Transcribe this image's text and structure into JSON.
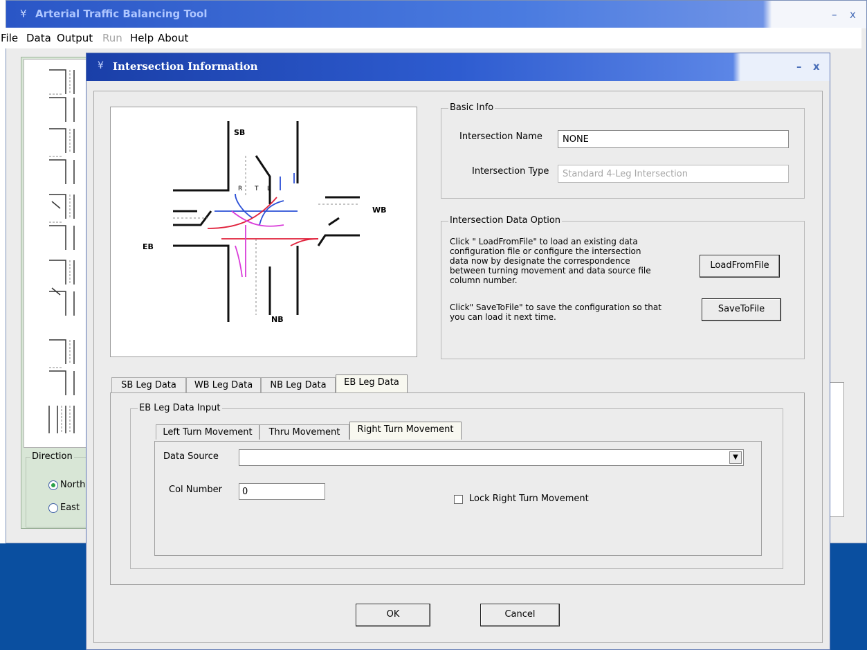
{
  "main_window": {
    "title": "Arterial Traffic Balancing Tool",
    "controls": {
      "minimize": "–",
      "close": "x"
    },
    "menu": [
      {
        "label": "File",
        "enabled": true
      },
      {
        "label": "Data",
        "enabled": true
      },
      {
        "label": "Output",
        "enabled": true
      },
      {
        "label": "Run",
        "enabled": false
      },
      {
        "label": "Help",
        "enabled": true
      },
      {
        "label": "About",
        "enabled": true
      }
    ],
    "direction_group": {
      "legend": "Direction",
      "options": [
        {
          "label": "North",
          "selected": true
        },
        {
          "label": "East",
          "selected": false
        }
      ]
    }
  },
  "dialog": {
    "title": "Intersection Information",
    "controls": {
      "minimize": "–",
      "close": "x"
    },
    "diagram_labels": {
      "sb": "SB",
      "wb": "WB",
      "eb": "EB",
      "nb": "NB",
      "r": "R",
      "t": "T",
      "l": "L"
    },
    "basic_info": {
      "legend": "Basic Info",
      "name_label": "Intersection Name",
      "name_value": "NONE",
      "type_label": "Intersection Type",
      "type_value": "Standard 4-Leg Intersection"
    },
    "data_option": {
      "legend": "Intersection Data Option",
      "load_desc": "Click \" LoadFromFile\" to load an existing data configuration file or configure the intersection data now by designate the correspondence between turning movement and data source file column number.",
      "save_desc": "Click\" SaveToFile\" to save the configuration so that you can load it next time.",
      "load_button": "LoadFromFile",
      "save_button": "SaveToFile"
    },
    "leg_tabs": [
      "SB Leg Data",
      "WB Leg Data",
      "NB Leg Data",
      "EB Leg Data"
    ],
    "active_leg_tab": "EB Leg Data",
    "leg_input": {
      "legend": "EB Leg  Data Input",
      "movement_tabs": [
        "Left Turn Movement",
        "Thru Movement",
        "Right Turn Movement"
      ],
      "active_movement_tab": "Right Turn Movement",
      "data_source_label": "Data Source",
      "data_source_value": "",
      "col_number_label": "Col  Number",
      "col_number_value": "0",
      "lock_label": "Lock Right Turn Movement",
      "lock_checked": false
    },
    "ok_button": "OK",
    "cancel_button": "Cancel"
  },
  "colors": {
    "titlebar": "#2e5cd0",
    "radio_selected": "#2aa14a",
    "arrow_blue": "#2a4fd6",
    "arrow_red": "#e0203a",
    "arrow_magenta": "#d93bd9"
  }
}
